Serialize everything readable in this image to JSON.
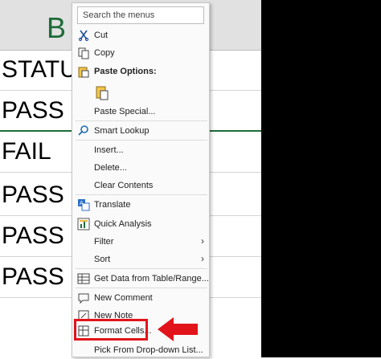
{
  "sheet": {
    "column_letter": "B",
    "cells": [
      "STATU",
      "PASS",
      "FAIL",
      "PASS",
      "PASS",
      "PASS"
    ]
  },
  "menu": {
    "search_placeholder": "Search the menus",
    "items": {
      "cut": "Cut",
      "copy": "Copy",
      "paste_options": "Paste Options:",
      "paste_special": "Paste Special...",
      "smart_lookup": "Smart Lookup",
      "insert": "Insert...",
      "delete": "Delete...",
      "clear_contents": "Clear Contents",
      "translate": "Translate",
      "quick_analysis": "Quick Analysis",
      "filter": "Filter",
      "sort": "Sort",
      "get_data": "Get Data from Table/Range...",
      "new_comment": "New Comment",
      "new_note": "New Note",
      "format_cells": "Format Cells...",
      "pick_dropdown": "Pick From Drop-down List..."
    }
  },
  "colors": {
    "accent_green": "#1e6b3a",
    "highlight_red": "#e2141b"
  }
}
